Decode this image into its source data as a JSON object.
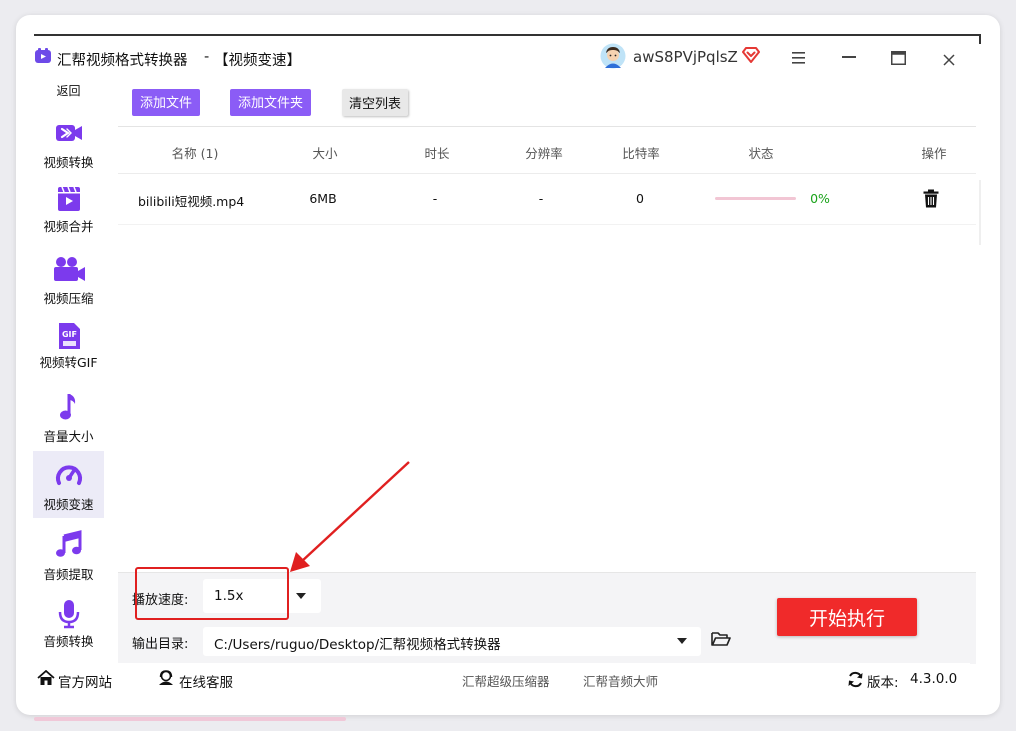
{
  "window": {
    "title": "汇帮视频格式转换器",
    "separator": "-",
    "subtitle": "【视频变速】",
    "username": "awS8PVjPqlsZ"
  },
  "sidebar": {
    "back_label": "返回",
    "items": [
      {
        "label": "视频转换",
        "icon": "video-convert-icon"
      },
      {
        "label": "视频合并",
        "icon": "video-merge-icon"
      },
      {
        "label": "视频压缩",
        "icon": "video-camera-icon"
      },
      {
        "label": "视频转GIF",
        "icon": "gif-icon"
      },
      {
        "label": "音量大小",
        "icon": "music-note-icon"
      },
      {
        "label": "视频变速",
        "icon": "speedometer-icon"
      },
      {
        "label": "音频提取",
        "icon": "music-notes-icon"
      },
      {
        "label": "音频转换",
        "icon": "microphone-icon"
      }
    ],
    "active_index": 5
  },
  "toolbar": {
    "add_file": "添加文件",
    "add_folder": "添加文件夹",
    "clear_list": "清空列表"
  },
  "table": {
    "headers": [
      "名称 (1)",
      "大小",
      "时长",
      "分辨率",
      "比特率",
      "状态",
      "操作"
    ],
    "rows": [
      {
        "name": "bilibili短视频.mp4",
        "size": "6MB",
        "duration": "-",
        "resolution": "-",
        "bitrate": "0",
        "progress_percent": 0,
        "progress_text": "0%"
      }
    ]
  },
  "settings": {
    "speed_label": "播放速度:",
    "speed_value": "1.5x",
    "output_label": "输出目录:",
    "output_path": "C:/Users/ruguo/Desktop/汇帮视频格式转换器"
  },
  "start_button": "开始执行",
  "footer": {
    "official_site": "官方网站",
    "online_service": "在线客服",
    "link1": "汇帮超级压缩器",
    "link2": "汇帮音频大师",
    "version_label": "版本:",
    "version": "4.3.0.0"
  },
  "colors": {
    "accent": "#8b5cf6",
    "sidebar_icon": "#7c3aed",
    "start_button": "#f02a2a",
    "annotation": "#e02020",
    "progress_text": "#1aa31a",
    "progress_track": "#f2c6d4"
  }
}
